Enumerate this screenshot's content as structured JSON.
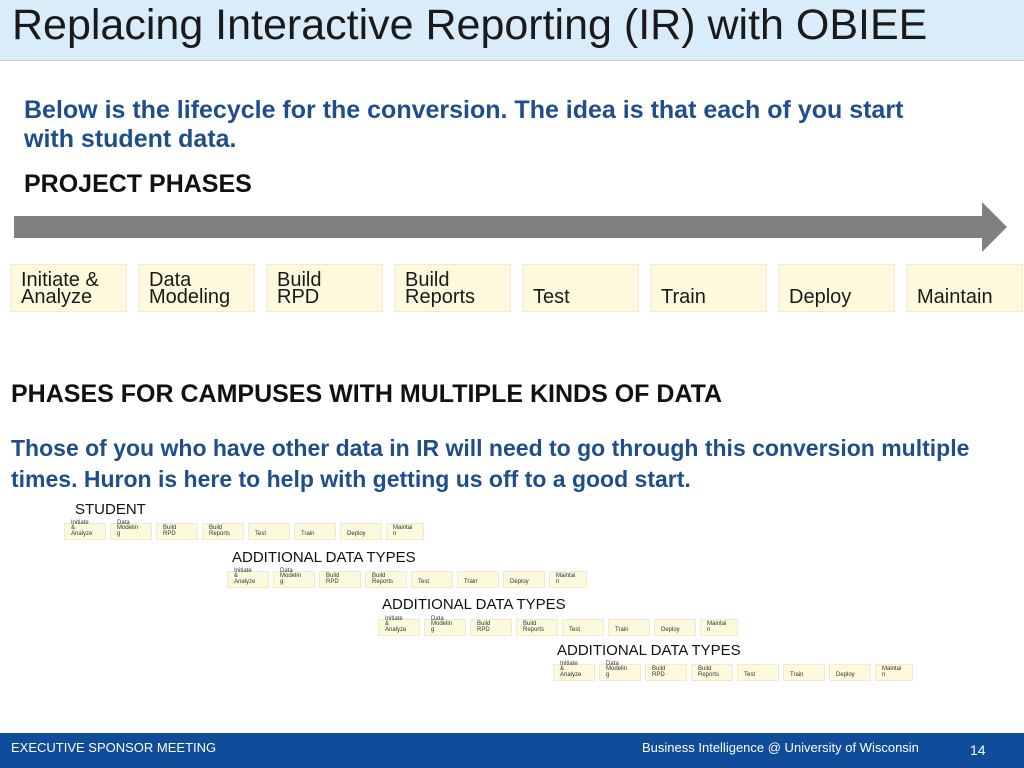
{
  "title": "Replacing Interactive Reporting (IR) with OBIEE",
  "intro": "Below is the lifecycle for the conversion. The idea is that each of you start with student data.",
  "project_phases_heading": "PROJECT PHASES",
  "phases": [
    {
      "label": "Initiate &\nAnalyze"
    },
    {
      "label": "Data\nModeling"
    },
    {
      "label": "Build\nRPD"
    },
    {
      "label": "Build\nReports"
    },
    {
      "label": "Test"
    },
    {
      "label": "Train"
    },
    {
      "label": "Deploy"
    },
    {
      "label": "Maintain"
    }
  ],
  "multi_heading": "PHASES FOR CAMPUSES WITH MULTIPLE KINDS OF DATA",
  "multi_text": "Those of you who have other data in IR will need to go through this conversion multiple times. Huron is here to help with getting us off to a good start.",
  "mini_phases": [
    {
      "label": "Initiate\n&\nAnalyze"
    },
    {
      "label": "Data\nModelin\ng"
    },
    {
      "label": "Build\nRPD"
    },
    {
      "label": "Build\nReports"
    },
    {
      "label": "Test"
    },
    {
      "label": "Train"
    },
    {
      "label": "Deploy"
    },
    {
      "label": "Maintai\nn"
    }
  ],
  "rows": [
    {
      "label": "STUDENT"
    },
    {
      "label": "ADDITIONAL DATA TYPES"
    },
    {
      "label": "ADDITIONAL DATA TYPES"
    },
    {
      "label": "ADDITIONAL DATA TYPES"
    }
  ],
  "footer": {
    "left": "EXECUTIVE SPONSOR MEETING",
    "right": "Business Intelligence @ University of Wisconsin",
    "page": "14"
  },
  "colors": {
    "title_band": "#d9ecfa",
    "accent_blue": "#1f4e8c",
    "phase_box": "#fdf9dc",
    "arrow": "#808080",
    "footer": "#0f4c9a"
  }
}
